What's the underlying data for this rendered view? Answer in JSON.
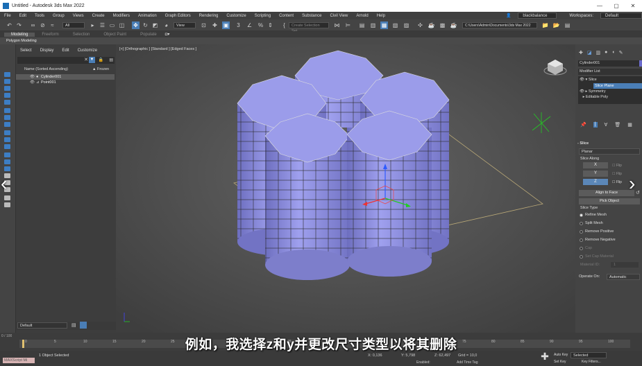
{
  "titlebar": {
    "title": "Untitled - Autodesk 3ds Max 2022"
  },
  "menu": {
    "items": [
      "File",
      "Edit",
      "Tools",
      "Group",
      "Views",
      "Create",
      "Modifiers",
      "Animation",
      "Graph Editors",
      "Rendering",
      "Customize",
      "Scripting",
      "Content",
      "Substance",
      "Civil View",
      "Arnold",
      "Help"
    ],
    "user": "blackbalance",
    "workspaces_label": "Workspaces:",
    "workspace": "Default"
  },
  "toolbar": {
    "selection_filter": "All",
    "view": "View",
    "create_selection_set": "Create Selection Set",
    "path": "C:\\Users\\Admin\\Documents\\3ds Max 2022"
  },
  "ribbon": {
    "tabs": [
      "Modeling",
      "Freeform",
      "Selection",
      "Object Paint",
      "Populate"
    ],
    "sub": "Polygon Modeling"
  },
  "scene": {
    "tabs": [
      "Select",
      "Display",
      "Edit",
      "Customize"
    ],
    "header_name": "Name (Sorted Ascending)",
    "header_frozen": "▲ Frozen",
    "items": [
      "Cylinder001",
      "Point001"
    ],
    "layer": "Default"
  },
  "viewport": {
    "label": "[+] [Orthographic ] [Standard ] [Edged Faces ]"
  },
  "right": {
    "object_name": "Cylinder001",
    "modifier_list": "Modifier List",
    "stack": [
      "Slice",
      "Slice Plane",
      "Symmetry",
      "Editable Poly"
    ],
    "rollout": "Slice",
    "slice_mode": "Planar",
    "slice_along": "Slice Along",
    "axes": [
      "X",
      "Y",
      "Z"
    ],
    "flip": "Flip",
    "align_to_face": "Align to Face",
    "pick_object": "Pick Object",
    "slice_type": "Slice Type",
    "types": [
      "Refine Mesh",
      "Split Mesh",
      "Remove Positive",
      "Remove Negative",
      "Cap",
      "Set Cap Material"
    ],
    "material_id_label": "Material ID:",
    "material_id": "1",
    "operate_on_label": "Operate On:",
    "operate_on": "Automatic"
  },
  "timeline": {
    "ticks": [
      "0",
      "5",
      "10",
      "15",
      "20",
      "25",
      "30",
      "35",
      "40",
      "45",
      "50",
      "55",
      "60",
      "65",
      "70",
      "75",
      "80",
      "85",
      "90",
      "95",
      "100"
    ],
    "frame": "0 / 100"
  },
  "status": {
    "selected": "1 Object Selected",
    "maxscript": "MAXScript Mi",
    "x": "0,136",
    "y": "5,798",
    "z": "62,497",
    "grid": "Grid = 10,0",
    "enabled": "Enabled:",
    "add_time_tag": "Add Time Tag",
    "auto_key": "Auto Key",
    "selected_key": "Selected",
    "set_key": "Set Key",
    "key_filters": "Key Filters..."
  },
  "subtitle": "例如，我选择z和y并更改尺寸类型以将其删除",
  "colors": {
    "accent": "#4a7eb6",
    "cylinder_top": "#9b9cea",
    "cylinder_side": "#8586d0",
    "viewport_bg": "#5a5a5a"
  }
}
